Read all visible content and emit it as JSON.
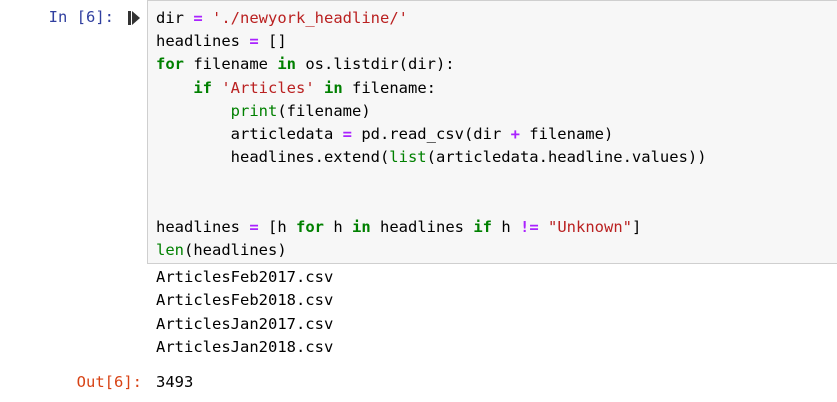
{
  "cell": {
    "in_prompt": "In [6]:",
    "out_prompt": "Out[6]:",
    "run_icon": "run-step-icon",
    "colors": {
      "in_prompt": "#303f9f",
      "out_prompt": "#d84315",
      "keyword": "#008000",
      "string": "#ba2121",
      "operator": "#aa22ff",
      "cell_background": "#f7f7f7",
      "cell_border": "#cfcfcf"
    },
    "code_lines": [
      "dir = './newyork_headline/'",
      "headlines = []",
      "for filename in os.listdir(dir):",
      "    if 'Articles' in filename:",
      "        print(filename)",
      "        articledata = pd.read_csv(dir + filename)",
      "        headlines.extend(list(articledata.headline.values))",
      "",
      "",
      "headlines = [h for h in headlines if h != \"Unknown\"]",
      "len(headlines)"
    ],
    "stdout_lines": [
      "ArticlesFeb2017.csv",
      "ArticlesFeb2018.csv",
      "ArticlesJan2017.csv",
      "ArticlesJan2018.csv"
    ],
    "result": "3493"
  }
}
